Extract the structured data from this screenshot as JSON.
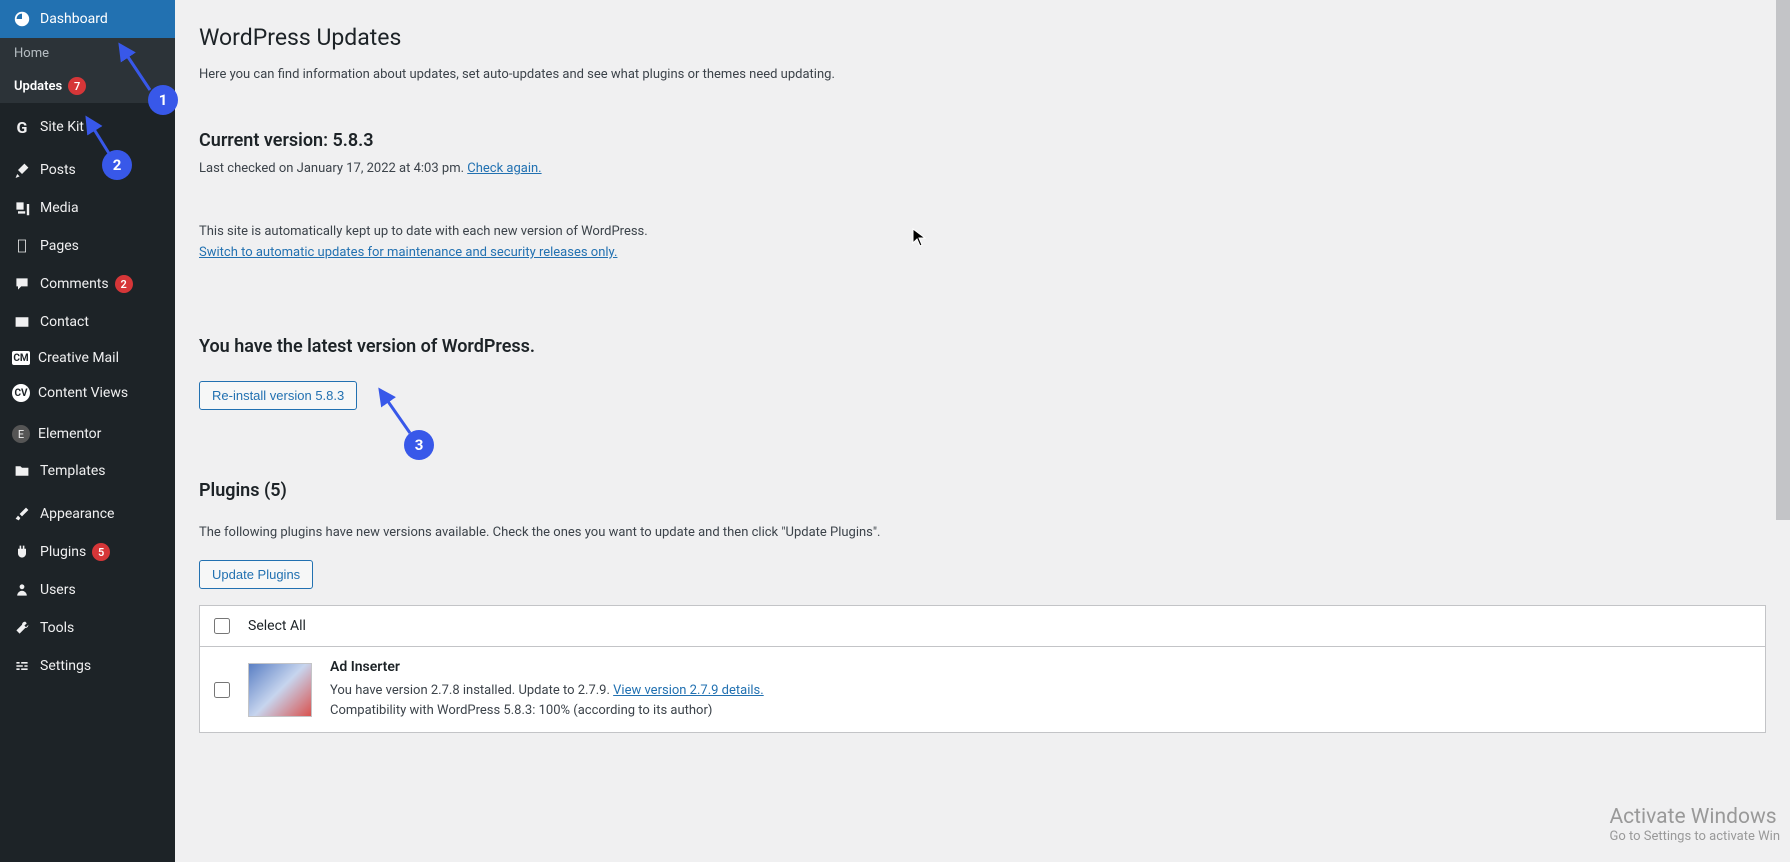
{
  "sidebar": {
    "dashboard": {
      "label": "Dashboard"
    },
    "submenu": {
      "home": "Home",
      "updates": "Updates",
      "updates_badge": "7"
    },
    "items": [
      {
        "label": "Site Kit",
        "icon": "G"
      },
      {
        "label": "Posts",
        "icon": "pin"
      },
      {
        "label": "Media",
        "icon": "media"
      },
      {
        "label": "Pages",
        "icon": "page"
      },
      {
        "label": "Comments",
        "icon": "comment",
        "badge": "2"
      },
      {
        "label": "Contact",
        "icon": "mail"
      },
      {
        "label": "Creative Mail",
        "icon": "cm"
      },
      {
        "label": "Content Views",
        "icon": "cv"
      },
      {
        "label": "Elementor",
        "icon": "el"
      },
      {
        "label": "Templates",
        "icon": "folder"
      },
      {
        "label": "Appearance",
        "icon": "brush"
      },
      {
        "label": "Plugins",
        "icon": "plug",
        "badge": "5"
      },
      {
        "label": "Users",
        "icon": "user"
      },
      {
        "label": "Tools",
        "icon": "wrench"
      },
      {
        "label": "Settings",
        "icon": "sliders"
      }
    ]
  },
  "page": {
    "title": "WordPress Updates",
    "intro": "Here you can find information about updates, set auto-updates and see what plugins or themes need updating.",
    "version_heading": "Current version: 5.8.3",
    "last_checked": "Last checked on January 17, 2022 at 4:03 pm. ",
    "check_again": "Check again.",
    "auto_update": "This site is automatically kept up to date with each new version of WordPress.",
    "switch_link": "Switch to automatic updates for maintenance and security releases only.",
    "latest": "You have the latest version of WordPress.",
    "reinstall_btn": "Re-install version 5.8.3",
    "plugins_heading": "Plugins (5)",
    "plugins_desc": "The following plugins have new versions available. Check the ones you want to update and then click \"Update Plugins\".",
    "update_plugins_btn": "Update Plugins",
    "select_all": "Select All",
    "plugin": {
      "name": "Ad Inserter",
      "line1a": "You have version 2.7.8 installed. Update to 2.7.9. ",
      "view_details": "View version 2.7.9 details.",
      "line2": "Compatibility with WordPress 5.8.3: 100% (according to its author)"
    }
  },
  "annotations": {
    "a1": "1",
    "a2": "2",
    "a3": "3"
  },
  "watermark": {
    "title": "Activate Windows",
    "sub": "Go to Settings to activate Win"
  }
}
